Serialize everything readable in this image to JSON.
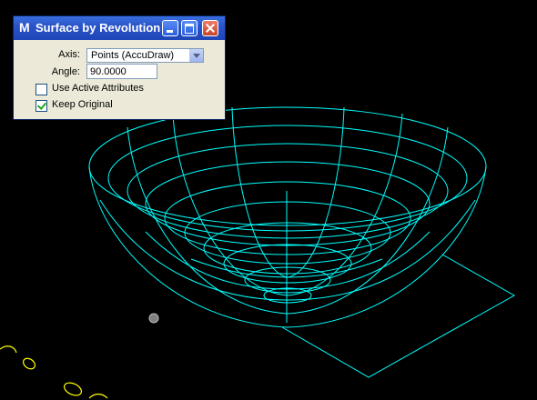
{
  "window": {
    "title": "Surface by Revolution",
    "app_icon_glyph": "M"
  },
  "form": {
    "axis_label": "Axis:",
    "axis_value": "Points (AccuDraw)",
    "angle_label": "Angle:",
    "angle_value": "90.0000",
    "use_active_attributes_label": "Use Active Attributes",
    "use_active_attributes_checked": false,
    "keep_original_label": "Keep Original",
    "keep_original_checked": true
  },
  "view": {
    "background_color": "#000000",
    "wireframe_color": "#00ffff",
    "text_color": "#ffff00"
  }
}
